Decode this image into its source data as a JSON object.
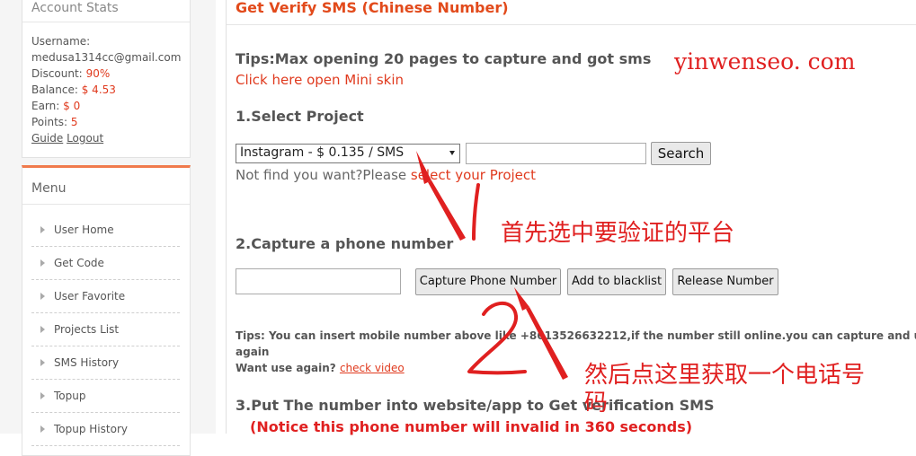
{
  "sidebar": {
    "stats": {
      "title": "Account Stats",
      "username_label": "Username:",
      "username": "medusa1314cc@gmail.com",
      "discount_label": "Discount:",
      "discount": "90%",
      "balance_label": "Balance:",
      "balance": "$ 4.53",
      "earn_label": "Earn:",
      "earn": "$ 0",
      "points_label": "Points:",
      "points": "5",
      "guide": "Guide",
      "logout": "Logout"
    },
    "menu": {
      "title": "Menu",
      "items": [
        "User Home",
        "Get Code",
        "User Favorite",
        "Projects List",
        "SMS History",
        "Topup",
        "Topup History"
      ]
    }
  },
  "main": {
    "title": "Get Verify SMS (Chinese Number)",
    "tips": "Tips:Max opening 20 pages to capture and got sms",
    "mini_skin_link": "Click here open Mini skin",
    "step1": "1.Select Project",
    "project_selected": "Instagram - $ 0.135 / SMS",
    "search_button": "Search",
    "not_find_prefix": "Not find you want?Please ",
    "not_find_link": "select your Project",
    "step2": "2.Capture a phone number",
    "capture_button": "Capture Phone Number",
    "blacklist_button": "Add to blacklist",
    "release_button": "Release Number",
    "tips2_line1": "Tips: You can insert mobile number above like +8613526632212,if the number still online.you can capture and u",
    "tips2_line2": "again",
    "want_use_again": "Want use again? ",
    "check_video": "check video",
    "step3": "3.Put The number into website/app to Get verification SMS",
    "notice": "(Notice this phone number will invalid in 360 seconds)"
  },
  "annotations": {
    "watermark": "yinwenseo. com",
    "note1": "首先选中要验证的平台",
    "note2_line1": "然后点这里获取一个电话号",
    "note2_line2": "码",
    "color": "#e02020"
  }
}
